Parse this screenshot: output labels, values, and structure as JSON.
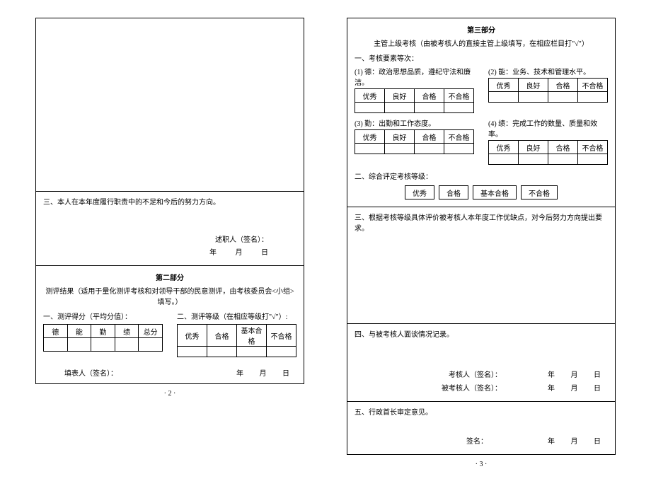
{
  "left": {
    "sec3_title": "三、本人在本年度履行职责中的不足和今后的努力方向。",
    "sig_label": "述职人（签名）：",
    "date_y": "年",
    "date_m": "月",
    "date_d": "日",
    "part2_title": "第二部分",
    "part2_sub": "测评结果（适用于量化测评考核和对领导干部的民意测评，由考核委员会<小组>填写。）",
    "score_label": "一、测评得分（平均分值）：",
    "grade_label": "二、测评等级（在相应等级打\"√\"）:",
    "cols": {
      "de": "德",
      "neng": "能",
      "qin": "勤",
      "ji": "绩",
      "zong": "总分"
    },
    "grades": {
      "yx": "优秀",
      "hg": "合格",
      "jbhg": "基本合格",
      "bhg": "不合格"
    },
    "filler": "填表人（签名）：",
    "pagenum": "· 2 ·"
  },
  "right": {
    "part3_title": "第三部分",
    "part3_sub": "主管上级考核（由被考核人的直接主管上级填写，在相应栏目打\"√\"）",
    "line1": "一、考核要素等次：",
    "c1": "(1) 德：政治思想品质，遵纪守法和廉洁。",
    "c2": "(2) 能：业务、技术和管理水平。",
    "c3": "(3) 勤：出勤和工作态度。",
    "c4": "(4) 绩：完成工作的数量、质量和效率。",
    "opts": {
      "yx": "优秀",
      "lh": "良好",
      "hg": "合格",
      "bhg": "不合格"
    },
    "line2": "二、综合评定考核等级：",
    "overall": {
      "yx": "优秀",
      "hg": "合格",
      "jbhg": "基本合格",
      "bhg": "不合格"
    },
    "sec3": "三、根据考核等级具体评价被考核人本年度工作优缺点，对今后努力方向提出要求。",
    "sec4": "四、与被考核人面谈情况记录。",
    "khr": "考核人（签名）：",
    "bkhr": "被考核人（签名）：",
    "sec5": "五、行政首长审定意见。",
    "sign": "签名：",
    "date_y": "年",
    "date_m": "月",
    "date_d": "日",
    "pagenum": "· 3 ·"
  }
}
